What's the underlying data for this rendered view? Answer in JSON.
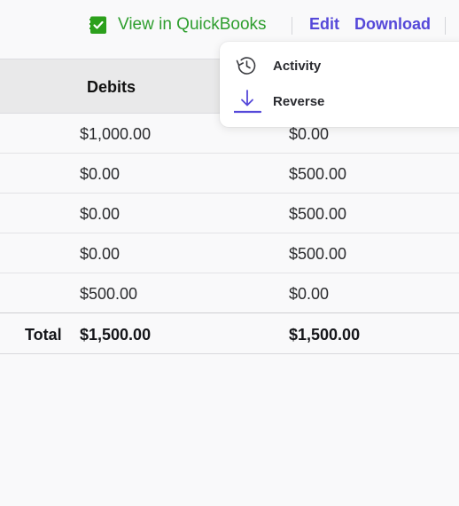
{
  "toolbar": {
    "quickbooks_label": "View in QuickBooks",
    "edit_label": "Edit",
    "download_label": "Download"
  },
  "table": {
    "columns": {
      "debits": "Debits"
    },
    "rows": [
      {
        "debit": "$1,000.00",
        "credit": "$0.00"
      },
      {
        "debit": "$0.00",
        "credit": "$500.00"
      },
      {
        "debit": "$0.00",
        "credit": "$500.00"
      },
      {
        "debit": "$0.00",
        "credit": "$500.00"
      },
      {
        "debit": "$500.00",
        "credit": "$0.00"
      }
    ],
    "total": {
      "label": "Total",
      "debit": "$1,500.00",
      "credit": "$1,500.00"
    }
  },
  "menu": {
    "items": [
      {
        "label": "Activity",
        "icon": "history-icon"
      },
      {
        "label": "Reverse",
        "icon": "download-arrow-icon"
      }
    ]
  },
  "colors": {
    "accent": "#5548d9",
    "quickbooks_green": "#2e9e2e"
  }
}
